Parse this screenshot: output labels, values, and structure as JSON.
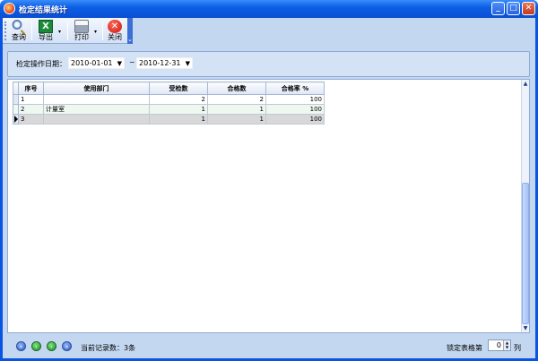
{
  "window": {
    "title": "检定结果统计",
    "controls": {
      "minimize": "_",
      "maximize": "□",
      "close": "✕"
    }
  },
  "toolbar": {
    "query_label": "查询",
    "export_label": "导出",
    "print_label": "打印",
    "close_label": "关闭",
    "excel_glyph": "X",
    "close_glyph": "✕",
    "dropdown_glyph": "▾"
  },
  "filter": {
    "label": "检定操作日期：",
    "start_date": "2010-01-01",
    "end_date": "2010-12-31",
    "separator": "~",
    "combo_arrow": "▼"
  },
  "grid": {
    "columns": [
      "序号",
      "使用部门",
      "受检数",
      "合格数",
      "合格率 %"
    ],
    "rows": [
      {
        "no": "1",
        "dept": "",
        "inspected": "2",
        "qualified": "2",
        "rate": "100"
      },
      {
        "no": "2",
        "dept": "计量室",
        "inspected": "1",
        "qualified": "1",
        "rate": "100"
      },
      {
        "no": "3",
        "dept": "",
        "inspected": "1",
        "qualified": "1",
        "rate": "100"
      }
    ],
    "selected_row": 3
  },
  "status": {
    "record_count": "当前记录数：3条",
    "lock_label": "锁定表格第",
    "lock_value": "0",
    "lock_unit": "列",
    "nav": {
      "first": "«",
      "prev": "‹",
      "next": "›",
      "last": "»"
    }
  },
  "colors": {
    "titlebar": "#0a54e4",
    "client_bg": "#c4d7f0",
    "selected_row": "#d8d8d8",
    "alt_row": "#eef8f0"
  }
}
